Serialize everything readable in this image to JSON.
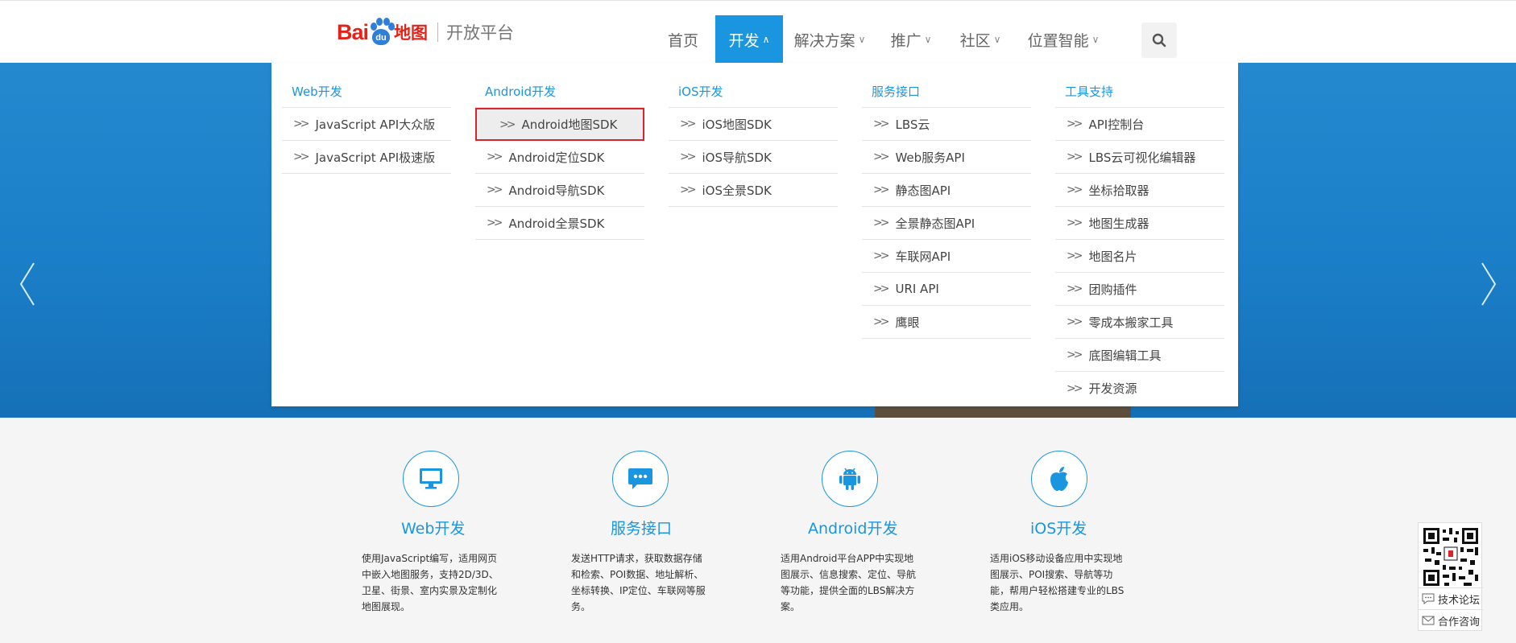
{
  "logo": {
    "bai": "Bai",
    "du": "du",
    "map": "地图",
    "platform": "开放平台"
  },
  "nav": {
    "items": [
      {
        "label": "首页",
        "dropdown": false
      },
      {
        "label": "开发",
        "dropdown": true,
        "active": true
      },
      {
        "label": "解决方案",
        "dropdown": true
      },
      {
        "label": "推广",
        "dropdown": true
      },
      {
        "label": "社区",
        "dropdown": true
      },
      {
        "label": "位置智能",
        "dropdown": true
      }
    ],
    "search_icon": "search-icon"
  },
  "menu": {
    "columns": [
      {
        "title": "Web开发",
        "items": [
          "JavaScript API大众版",
          "JavaScript API极速版"
        ]
      },
      {
        "title": "Android开发",
        "items": [
          "Android地图SDK",
          "Android定位SDK",
          "Android导航SDK",
          "Android全景SDK"
        ]
      },
      {
        "title": "iOS开发",
        "items": [
          "iOS地图SDK",
          "iOS导航SDK",
          "iOS全景SDK"
        ]
      },
      {
        "title": "服务接口",
        "items": [
          "LBS云",
          "Web服务API",
          "静态图API",
          "全景静态图API",
          "车联网API",
          "URI API",
          "鹰眼"
        ]
      },
      {
        "title": "工具支持",
        "items": [
          "API控制台",
          "LBS云可视化编辑器",
          "坐标拾取器",
          "地图生成器",
          "地图名片",
          "团购插件",
          "零成本搬家工具",
          "底图编辑工具",
          "开发资源"
        ]
      }
    ],
    "highlighted_item": "Android地图SDK"
  },
  "features": [
    {
      "icon": "monitor-icon",
      "title": "Web开发",
      "desc": "使用JavaScript编写，适用网页中嵌入地图服务，支持2D/3D、卫星、街景、室内实景及定制化地图展现。"
    },
    {
      "icon": "chat-icon",
      "title": "服务接口",
      "desc": "发送HTTP请求，获取数据存储和检索、POI数据、地址解析、坐标转换、IP定位、车联网等服务。"
    },
    {
      "icon": "android-icon",
      "title": "Android开发",
      "desc": "适用Android平台APP中实现地图展示、信息搜索、定位、导航等功能，提供全面的LBS解决方案。"
    },
    {
      "icon": "apple-icon",
      "title": "iOS开发",
      "desc": "适用iOS移动设备应用中实现地图展示、POI搜索、导航等功能，帮用户轻松搭建专业的LBS类应用。"
    }
  ],
  "side": {
    "forum": "技术论坛",
    "consult": "合作咨询"
  },
  "colors": {
    "accent": "#1a96e0",
    "brand_red": "#e2231a",
    "highlight_border": "#d9232d"
  }
}
